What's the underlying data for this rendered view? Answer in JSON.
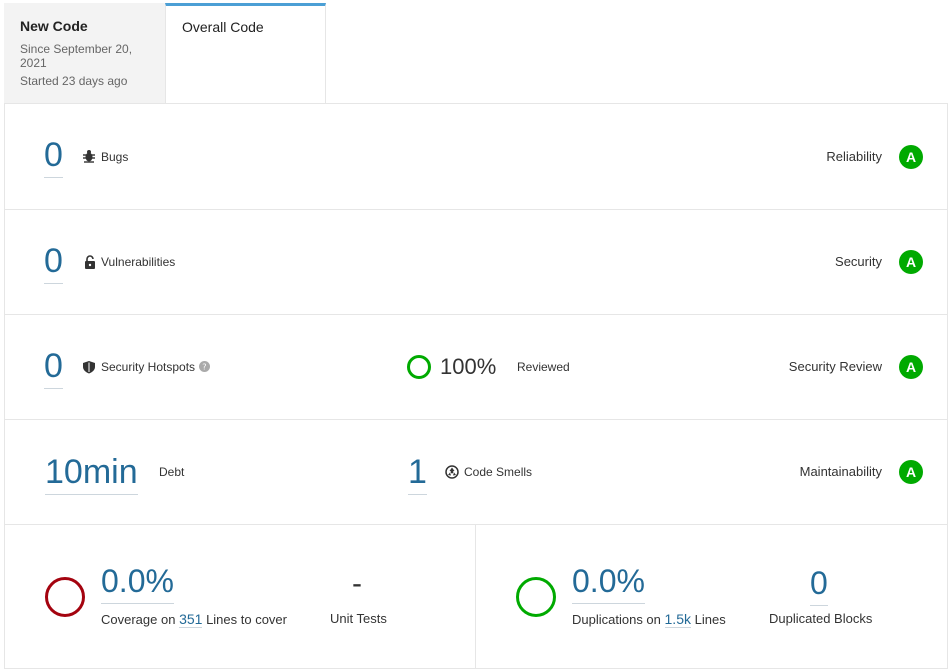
{
  "tabs": {
    "new_code": {
      "title": "New Code",
      "since": "Since September 20, 2021",
      "started": "Started 23 days ago"
    },
    "overall_code": {
      "title": "Overall Code"
    }
  },
  "reliability": {
    "value": "0",
    "label": "Bugs",
    "rating_label": "Reliability",
    "rating": "A"
  },
  "security": {
    "value": "0",
    "label": "Vulnerabilities",
    "rating_label": "Security",
    "rating": "A"
  },
  "hotspots": {
    "value": "0",
    "label": "Security Hotspots",
    "reviewed_value": "100%",
    "reviewed_label": "Reviewed",
    "rating_label": "Security Review",
    "rating": "A"
  },
  "maintainability": {
    "debt_value": "10min",
    "debt_label": "Debt",
    "smells_value": "1",
    "smells_label": "Code Smells",
    "rating_label": "Maintainability",
    "rating": "A"
  },
  "coverage": {
    "value": "0.0%",
    "prefix": "Coverage on",
    "lines": "351",
    "suffix": "Lines to cover",
    "unit_tests_value": "-",
    "unit_tests_label": "Unit Tests"
  },
  "duplications": {
    "value": "0.0%",
    "prefix": "Duplications on",
    "lines": "1.5k",
    "suffix": "Lines",
    "blocks_value": "0",
    "blocks_label": "Duplicated Blocks"
  },
  "colors": {
    "rating_green": "#00aa00",
    "link_blue": "#236a97",
    "coverage_red": "#a4030f",
    "duplication_green": "#00aa00",
    "tab_accent": "#4b9fd5"
  }
}
